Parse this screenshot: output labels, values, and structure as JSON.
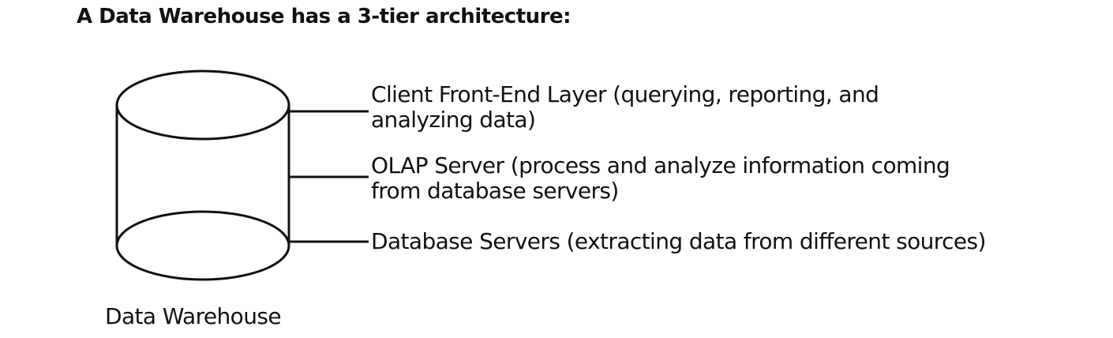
{
  "title": "A Data Warehouse has a 3-tier architecture:",
  "tiers": [
    {
      "line1": "Client Front-End Layer (querying, reporting, and",
      "line2": "analyzing data)"
    },
    {
      "line1": "OLAP Server (process and analyze information coming",
      "line2": "from database servers)"
    },
    {
      "line1": "Database Servers (extracting data from different sources)",
      "line2": ""
    }
  ],
  "cylinder_label": "Data Warehouse"
}
